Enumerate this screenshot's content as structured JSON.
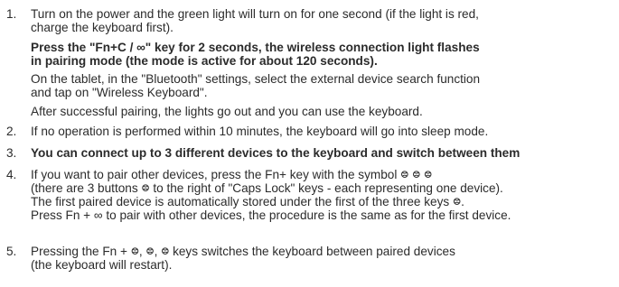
{
  "items": [
    {
      "number": "1.",
      "lines": [
        "Turn on the power and the green light will turn on for one second (if the light is red,",
        "charge the keyboard first)."
      ],
      "bold_lines": [
        "Press the \"Fn+C / ∞\" key for 2 seconds, the wireless connection light flashes",
        "in pairing mode (the mode is active for about 120 seconds)."
      ],
      "tablet_lines": [
        "On the tablet, in the \"Bluetooth\" settings, select the external device search function",
        "and tap on \"Wireless Keyboard\"."
      ],
      "after_line": "After successful pairing, the lights go out and you can use the keyboard."
    },
    {
      "number": "2.",
      "text": "If no operation is performed within 10 minutes, the keyboard will go into sleep mode."
    },
    {
      "number": "3.",
      "text": "You can connect up to 3 different devices to the keyboard and switch between them"
    },
    {
      "number": "4.",
      "lines": [
        "If you want to pair other devices, press the Fn+ key with the symbol ᳂ ᳂ ᳂",
        "(there are 3 buttons ᳂ to the right of \"Caps Lock\" keys - each representing one device).",
        "The first paired device is automatically stored under the first of the three keys ᳂.",
        "Press Fn + ∞ to pair with other devices, the procedure is the same as for the first device."
      ]
    },
    {
      "number": "5.",
      "lines": [
        "Pressing the Fn + ᳂, ᳂, ᳂ keys switches the keyboard between paired devices",
        "(the keyboard will restart)."
      ]
    }
  ]
}
